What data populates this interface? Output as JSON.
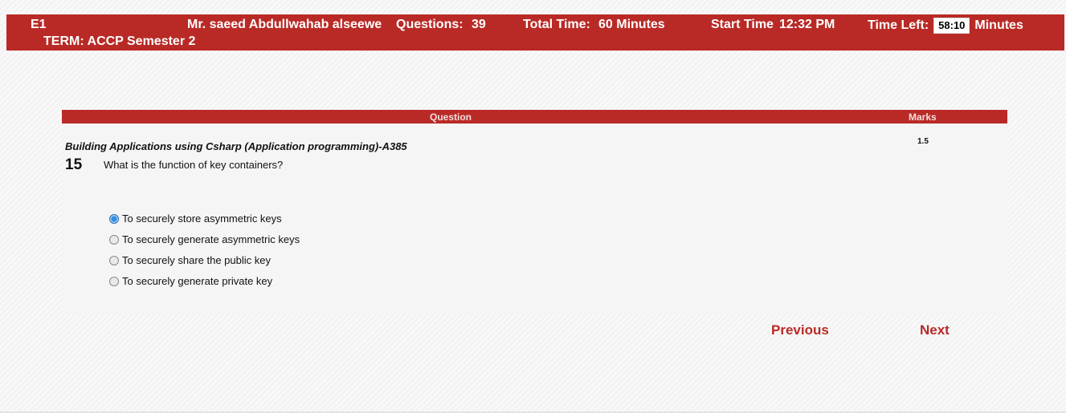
{
  "header": {
    "exam_code": "E1",
    "student_name": "Mr. saeed Abdullwahab alseewe",
    "questions_label": "Questions:",
    "questions_count": "39",
    "total_time_label": "Total Time:",
    "total_time_value": "60 Minutes",
    "start_time_label": "Start Time",
    "start_time_value": "12:32 PM",
    "time_left_label": "Time Left:",
    "time_left_value": "58:10",
    "time_left_unit": "Minutes",
    "term": "TERM: ACCP Semester 2"
  },
  "table": {
    "question_header": "Question",
    "marks_header": "Marks"
  },
  "question": {
    "subject": "Building Applications using Csharp (Application programming)-A385",
    "number": "15",
    "text": "What is the function of key containers?",
    "marks": "1.5",
    "options": [
      {
        "label": "To securely store asymmetric keys",
        "selected": true
      },
      {
        "label": "To securely generate asymmetric keys",
        "selected": false
      },
      {
        "label": "To securely share the public key",
        "selected": false
      },
      {
        "label": "To securely generate private key",
        "selected": false
      }
    ]
  },
  "nav": {
    "previous_label": "Previous",
    "next_label": "Next"
  },
  "colors": {
    "accent": "#b92a26",
    "background": "#f3f3f3"
  }
}
